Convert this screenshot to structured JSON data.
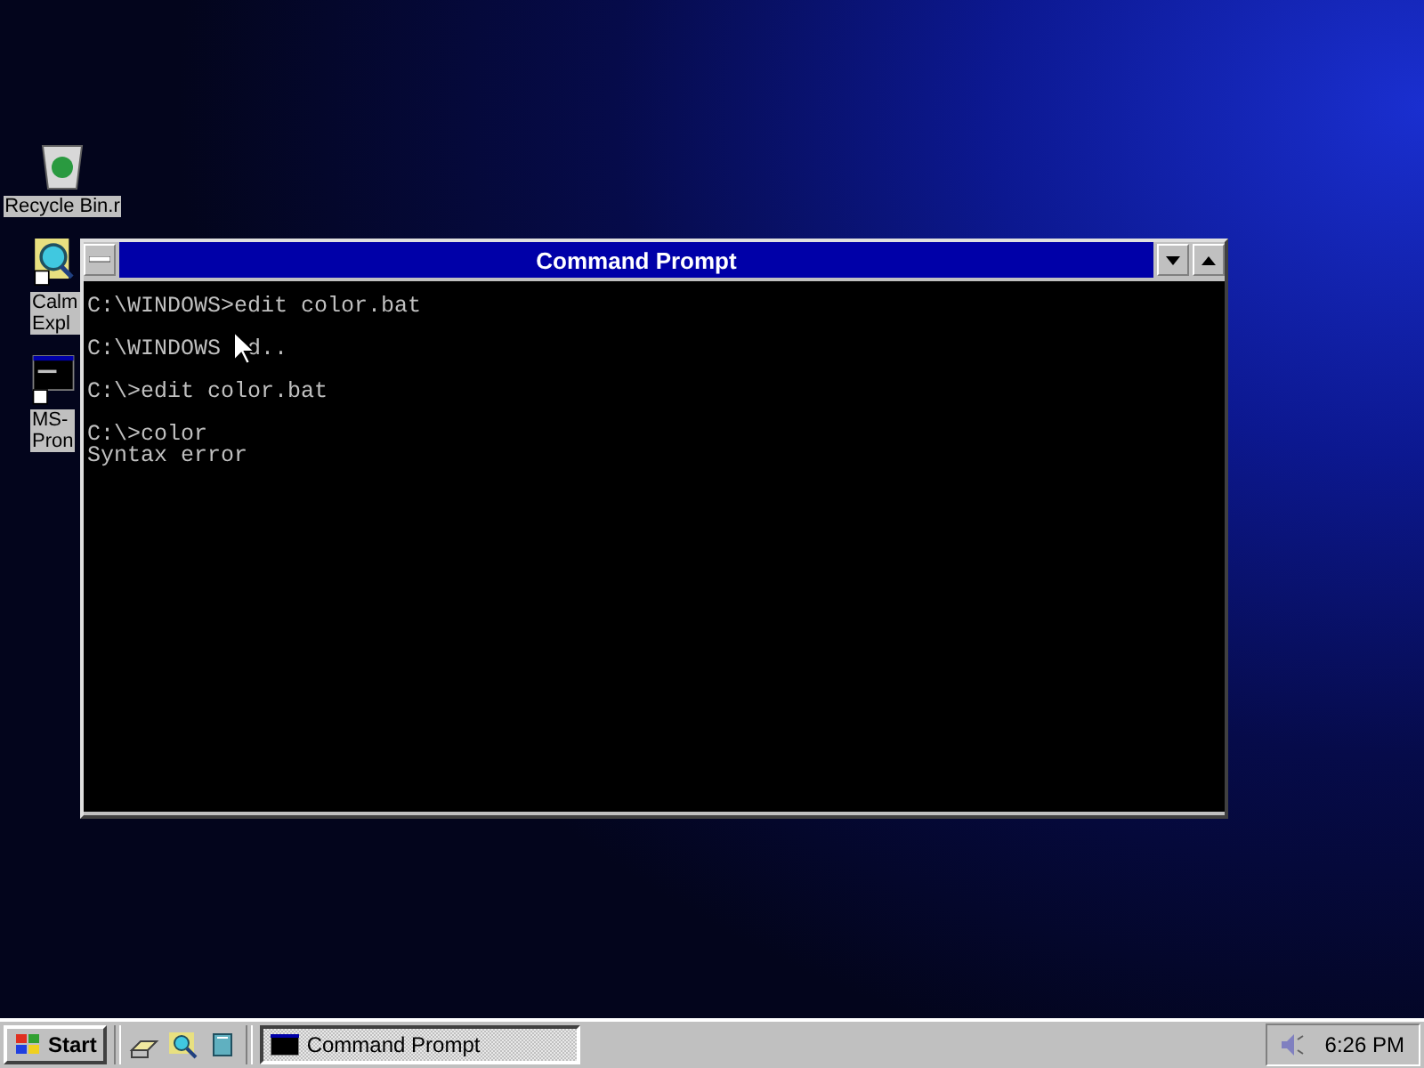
{
  "desktop_icons": [
    {
      "kind": "recycle",
      "label_lines": [
        "Recycle Bin.r"
      ]
    },
    {
      "kind": "explorer",
      "label_lines": [
        "Calm",
        "Expl"
      ]
    },
    {
      "kind": "dos",
      "label_lines": [
        "MS-",
        "Pron"
      ]
    }
  ],
  "window": {
    "title": "Command Prompt",
    "console_blocks": [
      [
        [
          "C:\\WINDOWS>edit color.bat"
        ]
      ],
      [
        [
          "C:\\WINDOWS",
          "d.."
        ]
      ],
      [
        [
          "C:\\>edit color.bat"
        ]
      ],
      [
        [
          "C:\\>color"
        ],
        [
          "Syntax error"
        ]
      ]
    ]
  },
  "taskbar": {
    "start": "Start",
    "quick_launch": [
      {
        "kind": "tray"
      },
      {
        "kind": "explorer"
      },
      {
        "kind": "book"
      }
    ],
    "tasks": [
      {
        "label": "Command Prompt",
        "selected": true
      }
    ],
    "clock": "6:26 PM"
  }
}
